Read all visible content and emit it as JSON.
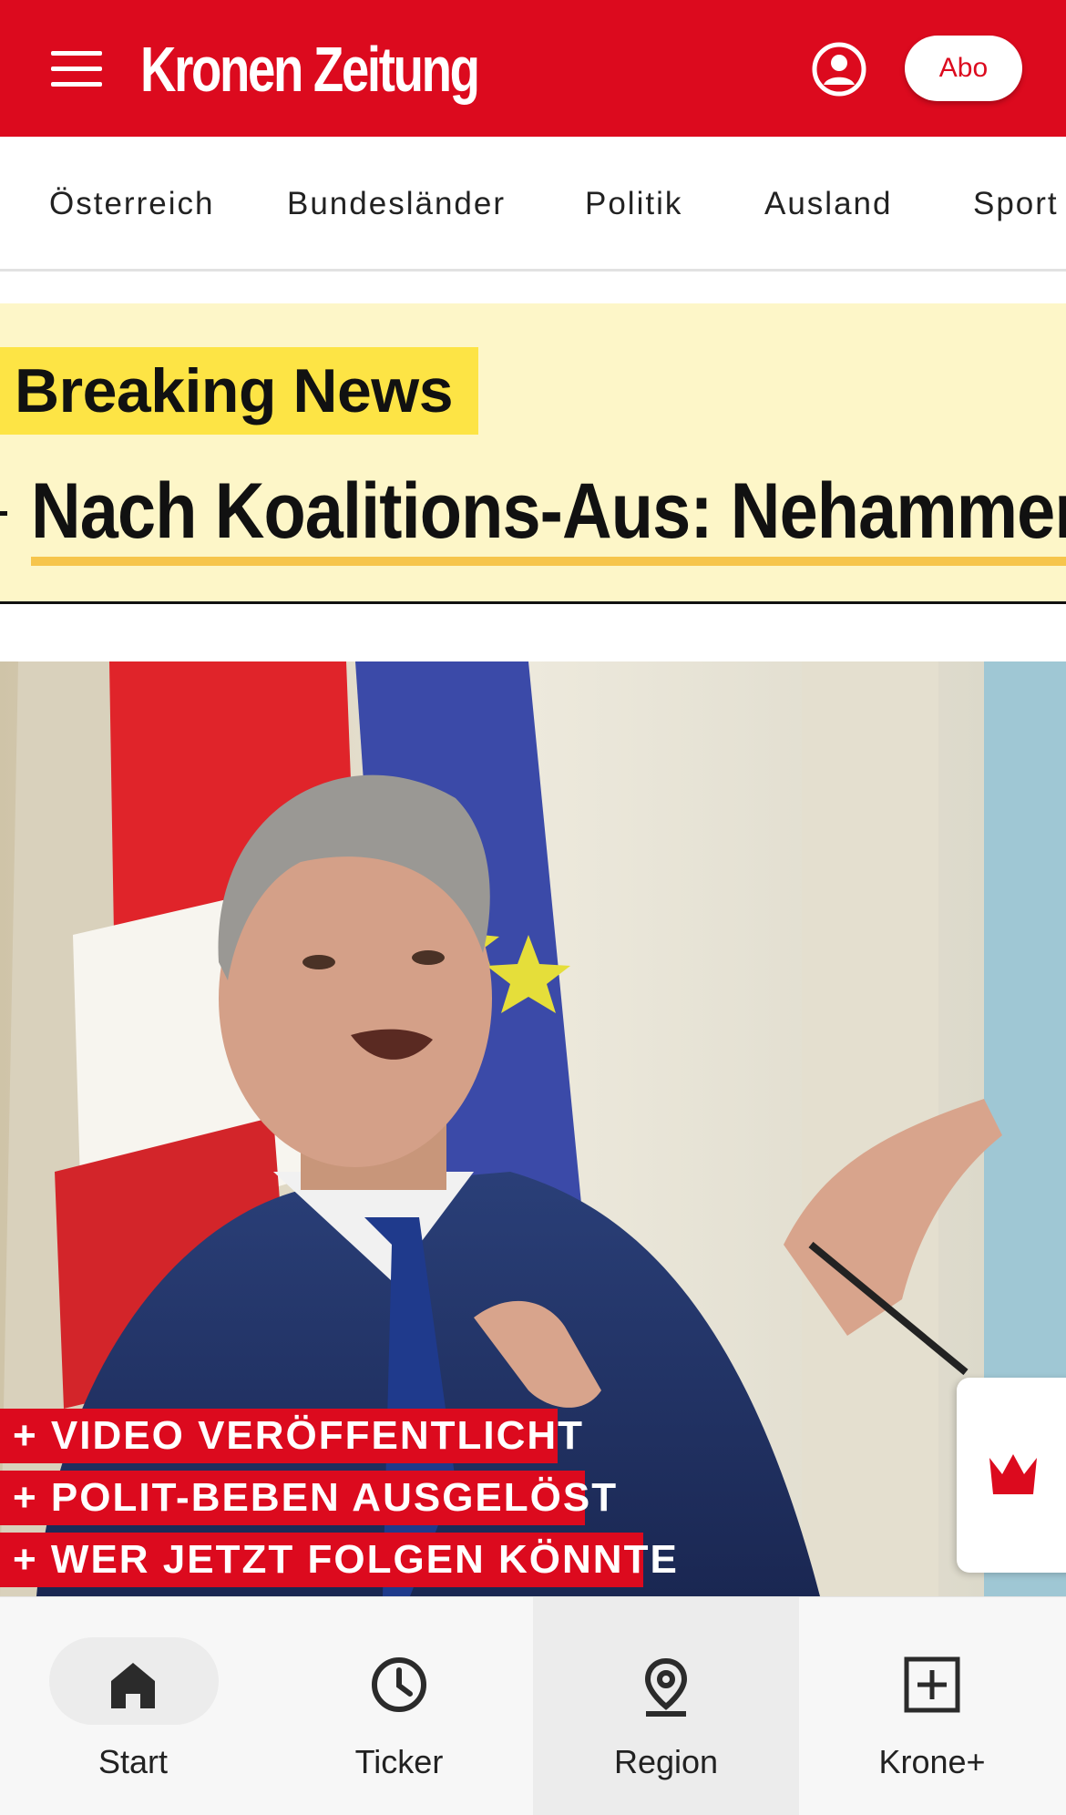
{
  "header": {
    "brand": "Kronen Zeitung",
    "abo_label": "Abo",
    "brand_color": "#dc0a1e"
  },
  "nav": {
    "items": [
      {
        "label": "Österreich"
      },
      {
        "label": "Bundesländer"
      },
      {
        "label": "Politik"
      },
      {
        "label": "Ausland"
      },
      {
        "label": "Sport"
      }
    ]
  },
  "breaking": {
    "label": "Breaking News",
    "headline": "Nach Koalitions-Aus: Nehammer",
    "label_color": "#fde445",
    "background_color": "#fdf6c8"
  },
  "hero": {
    "taglines": [
      "+ VIDEO VERÖFFENTLICHT",
      "+ POLIT-BEBEN AUSGELÖST",
      "+ WER JETZT FOLGEN KÖNNTE"
    ],
    "icons": [
      "crown-icon"
    ]
  },
  "bottom_nav": {
    "items": [
      {
        "label": "Start",
        "icon": "home-icon",
        "selected": true
      },
      {
        "label": "Ticker",
        "icon": "clock-icon",
        "selected": false
      },
      {
        "label": "Region",
        "icon": "location-pin-icon",
        "selected": false
      },
      {
        "label": "Krone+",
        "icon": "plus-square-icon",
        "selected": false
      }
    ]
  }
}
